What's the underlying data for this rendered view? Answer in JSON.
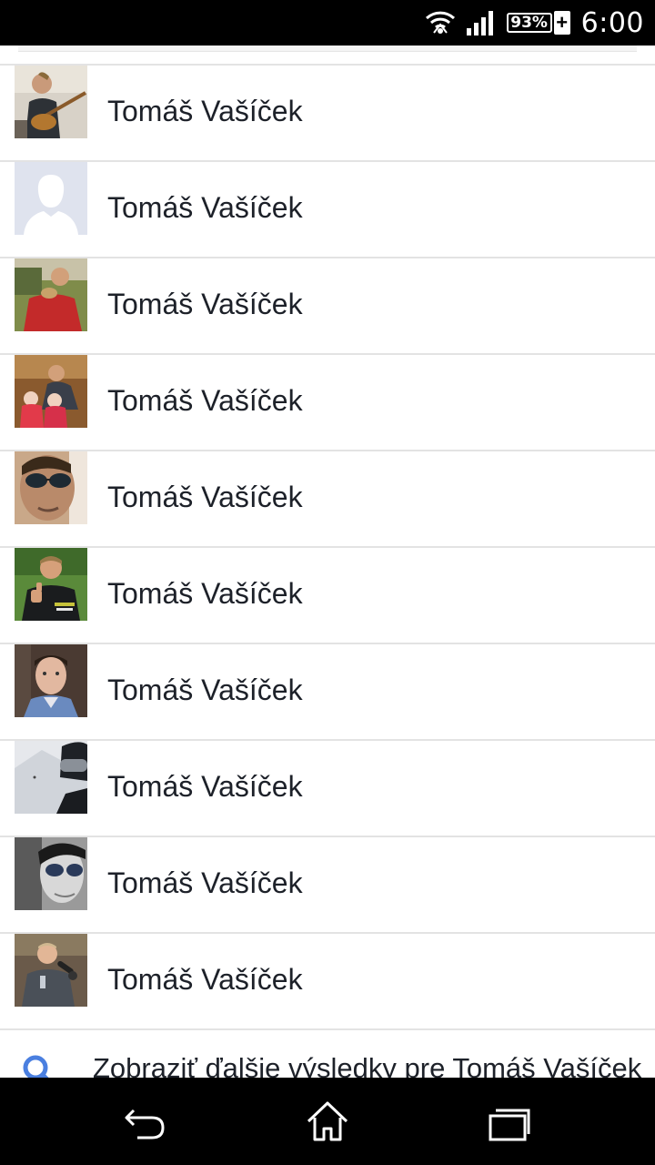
{
  "status_bar": {
    "battery_percent": "93%",
    "charging_symbol": "+",
    "time": "6:00",
    "icons": [
      "wifi-icon",
      "signal-icon",
      "battery-icon"
    ]
  },
  "results": [
    {
      "name": "Tomáš Vašíček",
      "avatar": "photo-guitar"
    },
    {
      "name": "Tomáš Vašíček",
      "avatar": "default-silhouette"
    },
    {
      "name": "Tomáš Vašíček",
      "avatar": "photo-red-shirt"
    },
    {
      "name": "Tomáš Vašíček",
      "avatar": "photo-family"
    },
    {
      "name": "Tomáš Vašíček",
      "avatar": "photo-sunglasses"
    },
    {
      "name": "Tomáš Vašíček",
      "avatar": "photo-thumbs-up"
    },
    {
      "name": "Tomáš Vašíček",
      "avatar": "photo-portrait"
    },
    {
      "name": "Tomáš Vašíček",
      "avatar": "photo-ski-goggles"
    },
    {
      "name": "Tomáš Vašíček",
      "avatar": "photo-bw-sunglasses"
    },
    {
      "name": "Tomáš Vašíček",
      "avatar": "photo-microphone"
    }
  ],
  "more_results": {
    "label": "Zobraziť ďalšie výsledky pre Tomáš Vašíček",
    "icon": "search-icon"
  },
  "nav_bar": {
    "icons": [
      "back-icon",
      "home-icon",
      "recent-apps-icon"
    ]
  },
  "colors": {
    "text": "#1d2129",
    "divider": "#e3e3e3",
    "search_accent": "#4a7fe0"
  }
}
